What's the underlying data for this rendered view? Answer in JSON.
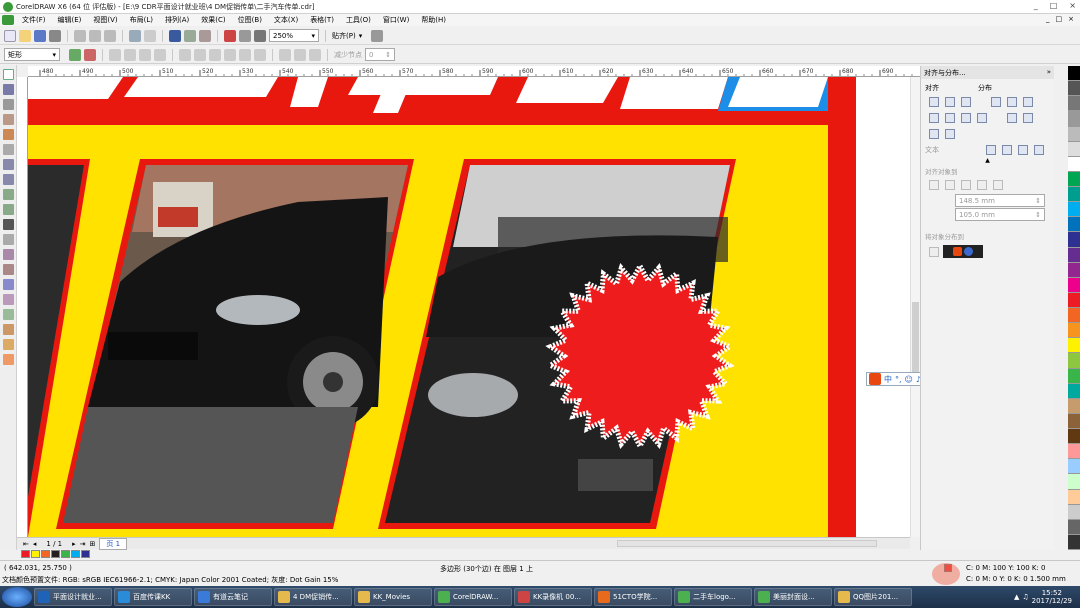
{
  "window": {
    "title": "CorelDRAW X6 (64 位 评估版) - [E:\\9 CDR平面设计就业班\\4 DM促销传单\\二手汽车传单.cdr]",
    "controls": [
      "_",
      "□",
      "×"
    ]
  },
  "menu": {
    "items": [
      "文件(F)",
      "编辑(E)",
      "视图(V)",
      "布局(L)",
      "排列(A)",
      "效果(C)",
      "位图(B)",
      "文本(X)",
      "表格(T)",
      "工具(O)",
      "窗口(W)",
      "帮助(H)"
    ],
    "right_controls": [
      "_",
      "□",
      "×"
    ]
  },
  "standard_toolbar": {
    "zoom": "250%",
    "snap": "贴齐(P)"
  },
  "property_bar": {
    "object_type": "矩形",
    "reduce_nodes_label": "减少节点",
    "reduce_nodes_value": "0"
  },
  "ruler": {
    "h_ticks": [
      "480",
      "490",
      "500",
      "510",
      "520",
      "530",
      "540",
      "550",
      "560",
      "570",
      "580",
      "590",
      "600",
      "610",
      "620",
      "630",
      "640",
      "650",
      "660",
      "670",
      "680",
      "690"
    ]
  },
  "docker": {
    "title": "对齐与分布...",
    "align_label": "对齐",
    "distribute_label": "分布",
    "text_label": "文本",
    "align_to_label": "对齐对象到",
    "x_value": "148.5 mm",
    "y_value": "105.0 mm",
    "distribute_to_label": "将对象分布到"
  },
  "palette": [
    "#000000",
    "#555555",
    "#777777",
    "#999999",
    "#bbbbbb",
    "#dddddd",
    "#ffffff",
    "#00a651",
    "#009e8f",
    "#00aeef",
    "#0072bc",
    "#2e3192",
    "#662d91",
    "#92278f",
    "#ec008c",
    "#ed1c24",
    "#f26522",
    "#f7941d",
    "#fff200",
    "#8dc63f",
    "#39b54a",
    "#00a99d",
    "#c69c6d",
    "#8c6239",
    "#603913",
    "#ff9999",
    "#99ccff",
    "#ccffcc",
    "#ffcc99",
    "#cccccc",
    "#666666",
    "#333333"
  ],
  "page_nav": {
    "position": "1 / 1",
    "page_tab": "页 1"
  },
  "color_well": [
    "#ed1c24",
    "#fff200",
    "#f26522",
    "#231f20",
    "#39b54a",
    "#00aeef",
    "#2e3192"
  ],
  "status": {
    "coords": "( 642.031, 25.750 )",
    "object_info": "多边形 (30个边) 在 图层 1 上",
    "color_profile": "文档颜色预置文件: RGB: sRGB IEC61966-2.1; CMYK: Japan Color 2001 Coated; 灰度: Dot Gain 15%",
    "fill_info": "C: 0 M: 100 Y: 100 K: 0",
    "outline_info": "C: 0 M: 0 Y: 0 K: 0  1.500 mm",
    "fill_color": "#ee1c1c"
  },
  "ime": {
    "label": "中"
  },
  "taskbar": {
    "items": [
      {
        "label": "平面设计就业...",
        "color": "#1e63b6"
      },
      {
        "label": "百度传课KK",
        "color": "#2a8cd8"
      },
      {
        "label": "有道云笔记",
        "color": "#3a7ad8"
      },
      {
        "label": "4 DM促销传...",
        "color": "#e5b94b"
      },
      {
        "label": "KK_Movies",
        "color": "#e5b94b"
      },
      {
        "label": "CorelDRAW...",
        "color": "#4caf50"
      },
      {
        "label": "KK录像机 00...",
        "color": "#c44"
      },
      {
        "label": "51CTO学院...",
        "color": "#e86a1c"
      },
      {
        "label": "二手车logo...",
        "color": "#4caf50"
      },
      {
        "label": "美丽封面设...",
        "color": "#4caf50"
      },
      {
        "label": "QQ图片201...",
        "color": "#e5b94b"
      }
    ],
    "clock_time": "15:52",
    "clock_date": "2017/12/29"
  }
}
